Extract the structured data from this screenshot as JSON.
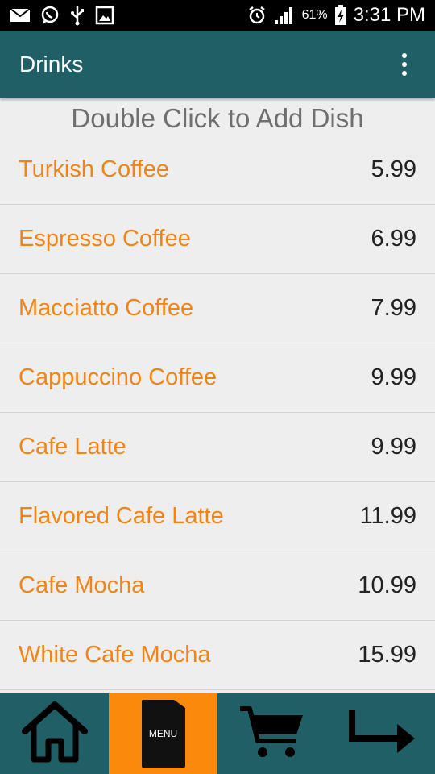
{
  "status_bar": {
    "battery_percent": "61%",
    "time": "3:31 PM",
    "icons": [
      "mail-icon",
      "whatsapp-icon",
      "usb-icon",
      "image-icon",
      "alarm-icon",
      "signal-icon",
      "battery-charging-icon"
    ]
  },
  "app_bar": {
    "title": "Drinks",
    "overflow_icon": "more-vert-icon"
  },
  "hint": "Double Click to Add Dish",
  "items": [
    {
      "name": "Turkish Coffee",
      "price": "5.99"
    },
    {
      "name": "Espresso Coffee",
      "price": "6.99"
    },
    {
      "name": "Macciatto Coffee",
      "price": "7.99"
    },
    {
      "name": "Cappuccino Coffee",
      "price": "9.99"
    },
    {
      "name": "Cafe Latte",
      "price": "9.99"
    },
    {
      "name": "Flavored Cafe Latte",
      "price": "11.99"
    },
    {
      "name": "Cafe Mocha",
      "price": "10.99"
    },
    {
      "name": "White Cafe Mocha",
      "price": "15.99"
    }
  ],
  "bottom_nav": {
    "menu_label": "MENU",
    "buttons": [
      "home-icon",
      "menu-icon",
      "cart-icon",
      "exit-arrow-icon"
    ],
    "active": "menu"
  },
  "colors": {
    "app_bar": "#215f66",
    "accent": "#fb8a0c",
    "item_name": "#f08414",
    "background": "#eeeeee"
  }
}
